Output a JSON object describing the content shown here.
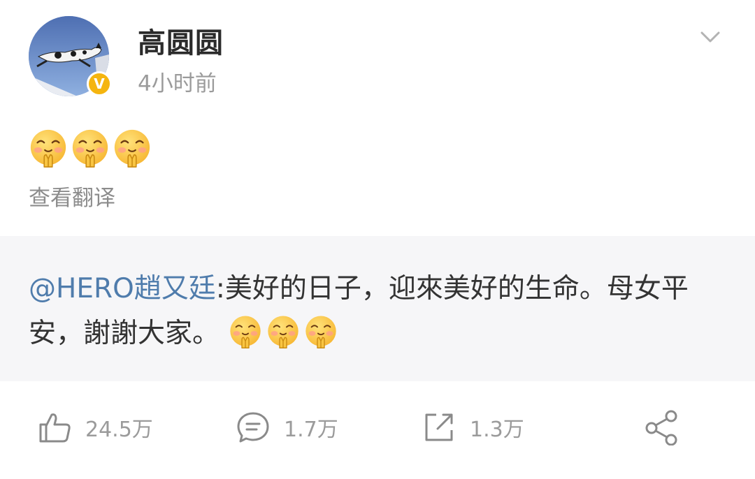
{
  "post": {
    "username": "高圆圆",
    "time": "4小时前",
    "verified_badge": "V",
    "emoji_name": "smiling-pray-emoji",
    "emoji_count": 3,
    "translate_label": "查看翻译"
  },
  "repost": {
    "mention": "@HERO趙又廷",
    "text": ":美好的日子，迎來美好的生命。母女平安，謝謝大家。",
    "emoji_count": 3
  },
  "actions": {
    "likes": "24.5万",
    "comments": "1.7万",
    "reposts": "1.3万"
  },
  "colors": {
    "mention": "#4f7cac",
    "verified_badge": "#f5b50f",
    "repost_bg": "#f6f6f8",
    "secondary_text": "#9b9b9b"
  }
}
